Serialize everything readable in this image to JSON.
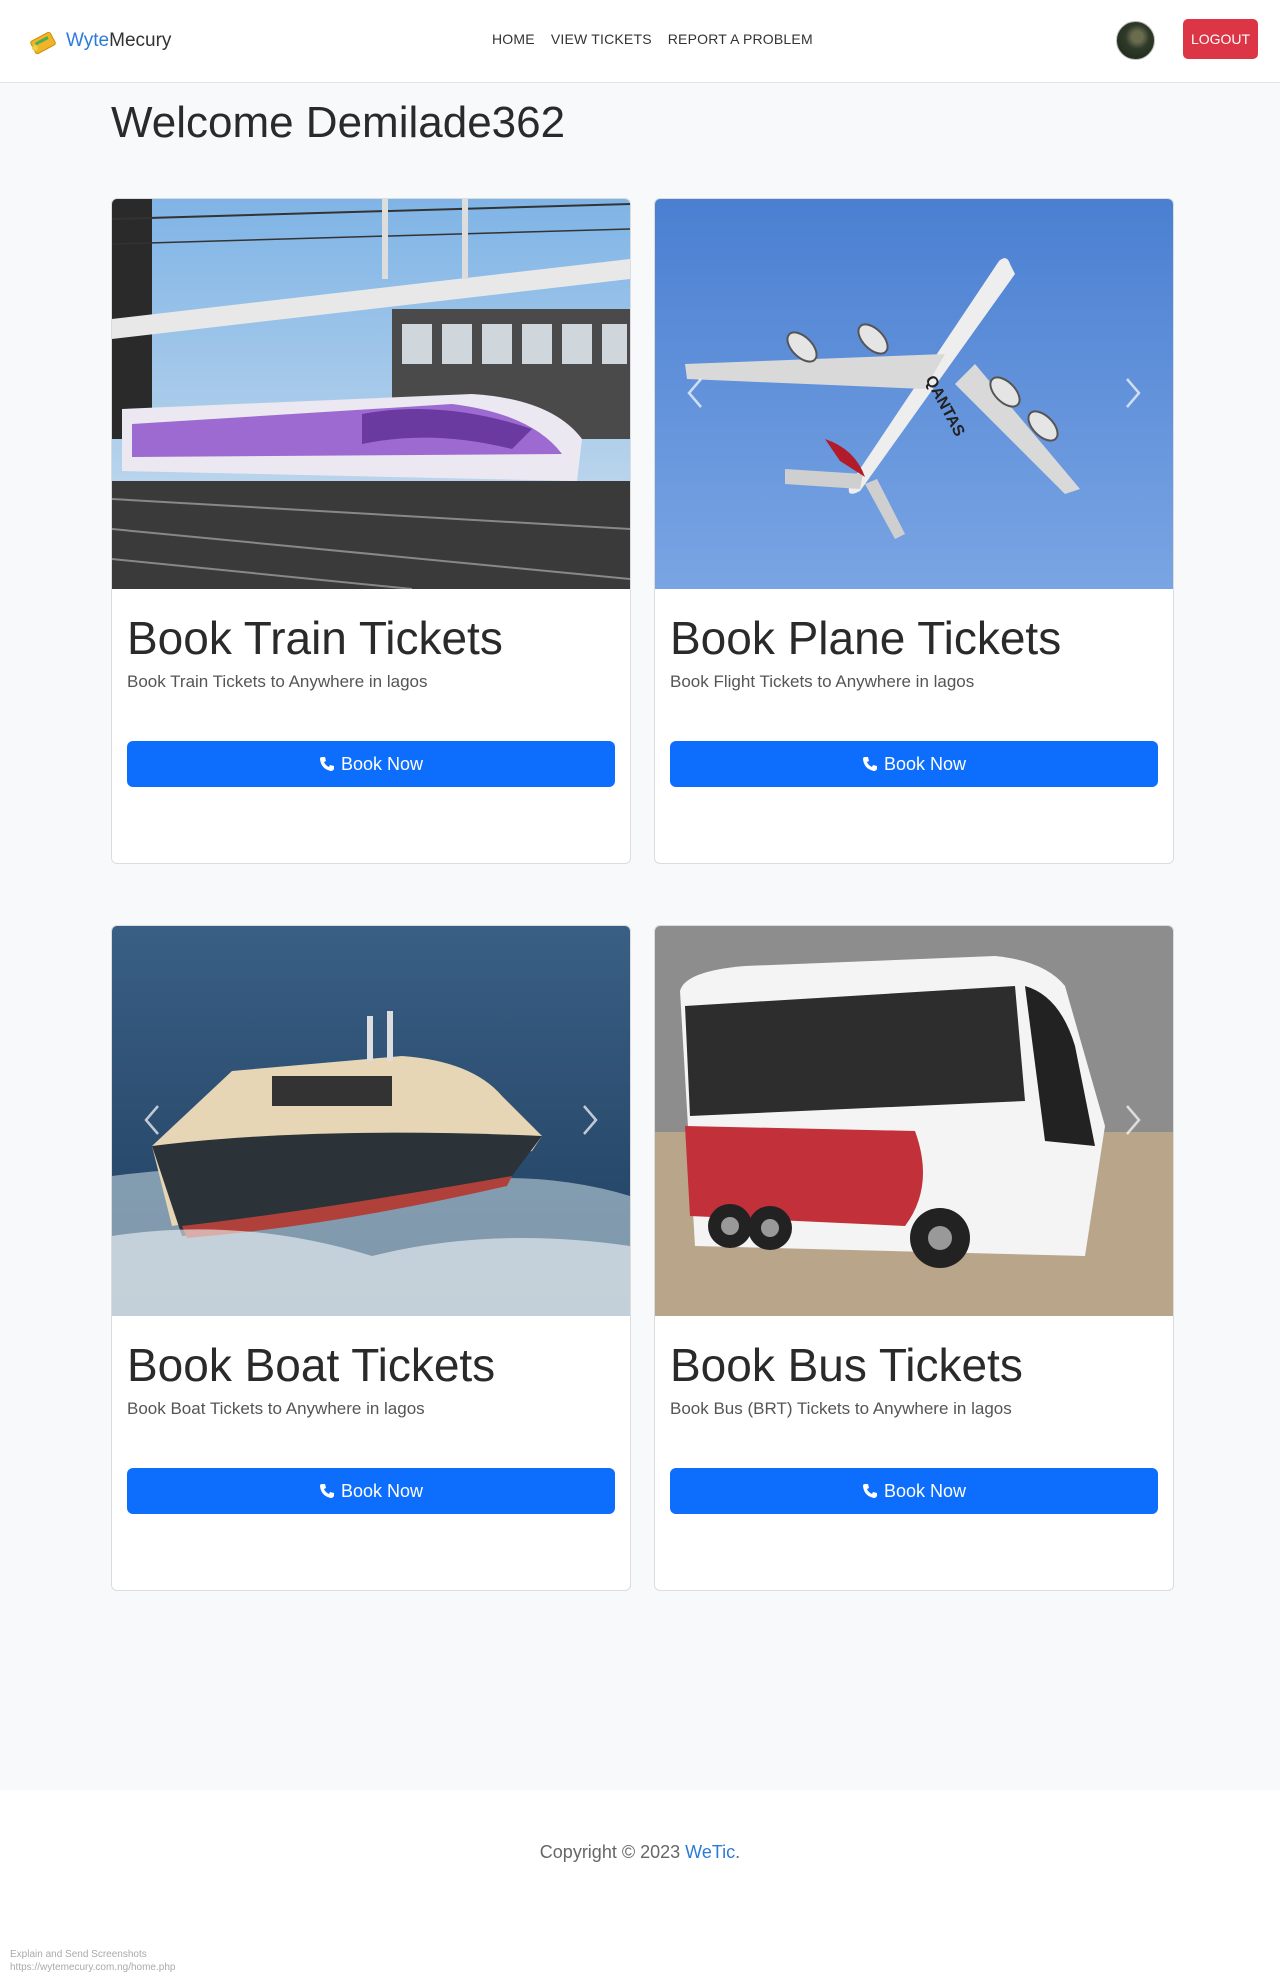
{
  "navbar": {
    "brand_part1": "Wyte",
    "brand_part2": "Mecury",
    "links": [
      "HOME",
      "VIEW TICKETS",
      "REPORT A PROBLEM"
    ],
    "logout_label": "LOGOUT"
  },
  "welcome": "Welcome Demilade362",
  "cards": [
    {
      "title": "Book Train Tickets",
      "text": "Book Train Tickets to Anywhere in lagos",
      "button": "Book Now",
      "image": "train-photo"
    },
    {
      "title": "Book Plane Tickets",
      "text": "Book Flight Tickets to Anywhere in lagos",
      "button": "Book Now",
      "image": "plane-photo"
    },
    {
      "title": "Book Boat Tickets",
      "text": "Book Boat Tickets to Anywhere in lagos",
      "button": "Book Now",
      "image": "boat-photo"
    },
    {
      "title": "Book Bus Tickets",
      "text": "Book Bus (BRT) Tickets to Anywhere in lagos",
      "button": "Book Now",
      "image": "bus-photo"
    }
  ],
  "footer": {
    "copyright_prefix": "Copyright © 2023 ",
    "brand": "WeTic",
    "suffix": "."
  },
  "watermark": {
    "line1": "Explain and Send Screenshots",
    "line2": "https://wytemecury.com.ng/home.php"
  },
  "colors": {
    "primary": "#0d6efd",
    "danger": "#dc3545",
    "brand_blue": "#2b7bd8",
    "background": "#f8f9fa"
  }
}
